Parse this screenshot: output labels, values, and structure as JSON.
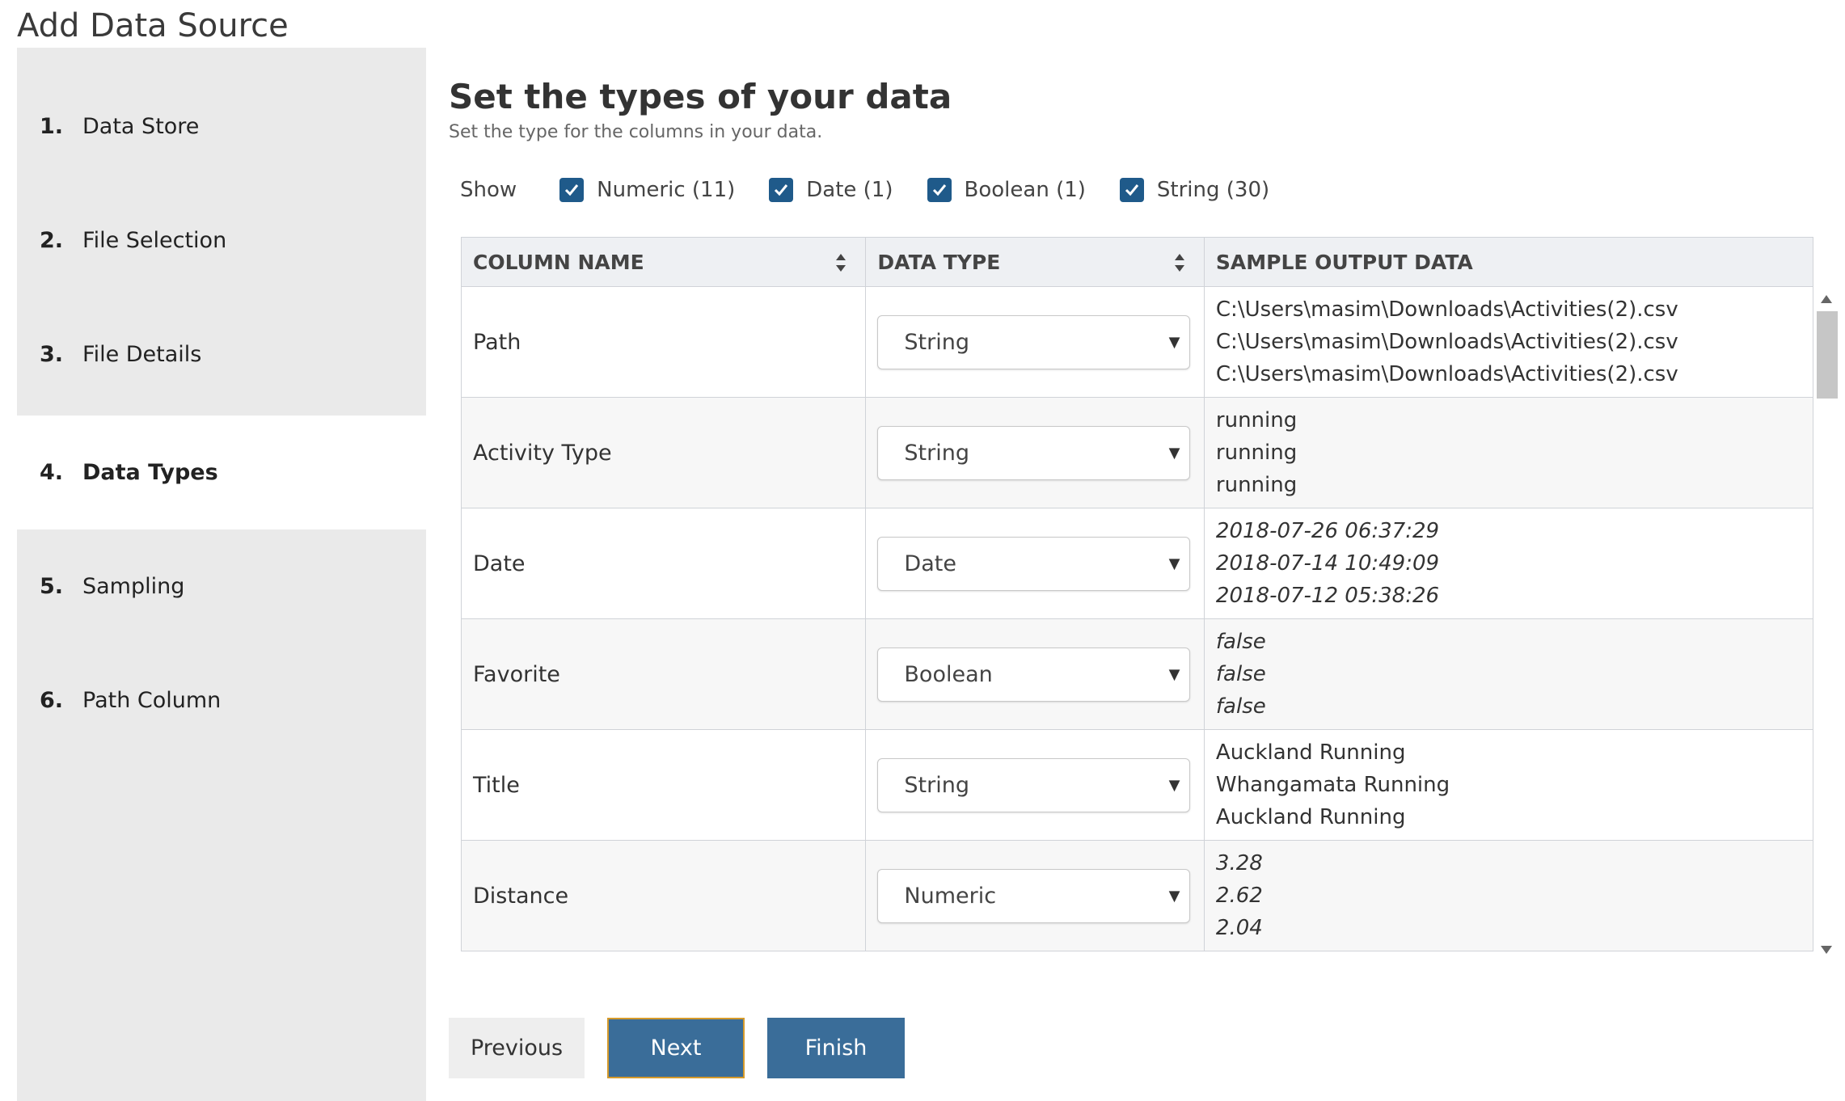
{
  "app": {
    "title": "Add Data Source"
  },
  "steps": [
    {
      "num": "1.",
      "label": "Data Store"
    },
    {
      "num": "2.",
      "label": "File Selection"
    },
    {
      "num": "3.",
      "label": "File Details"
    },
    {
      "num": "4.",
      "label": "Data Types",
      "active": true
    },
    {
      "num": "5.",
      "label": "Sampling"
    },
    {
      "num": "6.",
      "label": "Path Column"
    }
  ],
  "main": {
    "heading": "Set the types of your data",
    "subheading": "Set the type for the columns in your data.",
    "show_label": "Show",
    "filters": [
      {
        "label": "Numeric (11)",
        "checked": true
      },
      {
        "label": "Date (1)",
        "checked": true
      },
      {
        "label": "Boolean (1)",
        "checked": true
      },
      {
        "label": "String (30)",
        "checked": true
      }
    ],
    "checkbox_color": "#1f5a8a"
  },
  "table": {
    "headers": [
      "COLUMN NAME",
      "DATA TYPE",
      "SAMPLE OUTPUT DATA"
    ],
    "rows": [
      {
        "name": "Path",
        "type": "String",
        "samples": [
          "C:\\Users\\masim\\Downloads\\Activities(2).csv",
          "C:\\Users\\masim\\Downloads\\Activities(2).csv",
          "C:\\Users\\masim\\Downloads\\Activities(2).csv"
        ]
      },
      {
        "name": "Activity Type",
        "type": "String",
        "samples": [
          "running",
          "running",
          "running"
        ]
      },
      {
        "name": "Date",
        "type": "Date",
        "samples": [
          "2018-07-26 06:37:29",
          "2018-07-14 10:49:09",
          "2018-07-12 05:38:26"
        ]
      },
      {
        "name": "Favorite",
        "type": "Boolean",
        "samples": [
          "false",
          "false",
          "false"
        ]
      },
      {
        "name": "Title",
        "type": "String",
        "samples": [
          "Auckland Running",
          "Whangamata Running",
          "Auckland Running"
        ]
      },
      {
        "name": "Distance",
        "type": "Numeric",
        "samples": [
          "3.28",
          "2.62",
          "2.04"
        ]
      }
    ]
  },
  "buttons": {
    "previous": "Previous",
    "next": "Next",
    "finish": "Finish"
  },
  "colors": {
    "primary_button": "#3a6d99",
    "focus_border": "#d59a2b",
    "sidebar_bg": "#eaeaea"
  }
}
